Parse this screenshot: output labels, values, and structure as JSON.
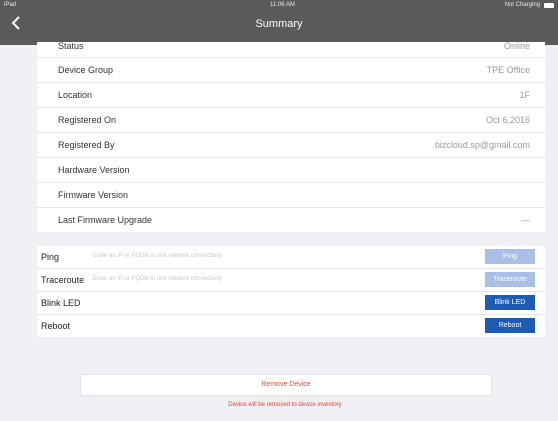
{
  "statusbar": {
    "carrier": "iPad",
    "time": "11:06 AM",
    "charging": "Not Charging"
  },
  "navbar": {
    "title": "Summary"
  },
  "device_info": [
    {
      "label": "Status",
      "value": "Online"
    },
    {
      "label": "Device Group",
      "value": "TPE Office"
    },
    {
      "label": "Location",
      "value": "1F"
    },
    {
      "label": "Registered On",
      "value": "Oct 6,2016"
    },
    {
      "label": "Registered By",
      "value": "bizcloud.sp@gmail.com"
    },
    {
      "label": "Hardware Version",
      "value": ""
    },
    {
      "label": "Firmware Version",
      "value": ""
    },
    {
      "label": "Last Firmware Upgrade",
      "value": "—"
    }
  ],
  "tools": {
    "ping": {
      "label": "Ping",
      "placeholder": "Enter an IP or FQDN to test network connectivity",
      "button": "Ping"
    },
    "traceroute": {
      "label": "Traceroute",
      "placeholder": "Enter an IP or FQDN to test network connectivity",
      "button": "Traceroute"
    },
    "blink": {
      "label": "Blink LED",
      "button": "Blink LED"
    },
    "reboot": {
      "label": "Reboot",
      "button": "Reboot"
    }
  },
  "remove": {
    "button": "Remove Device",
    "note": "Device will be removed to device inventory"
  }
}
